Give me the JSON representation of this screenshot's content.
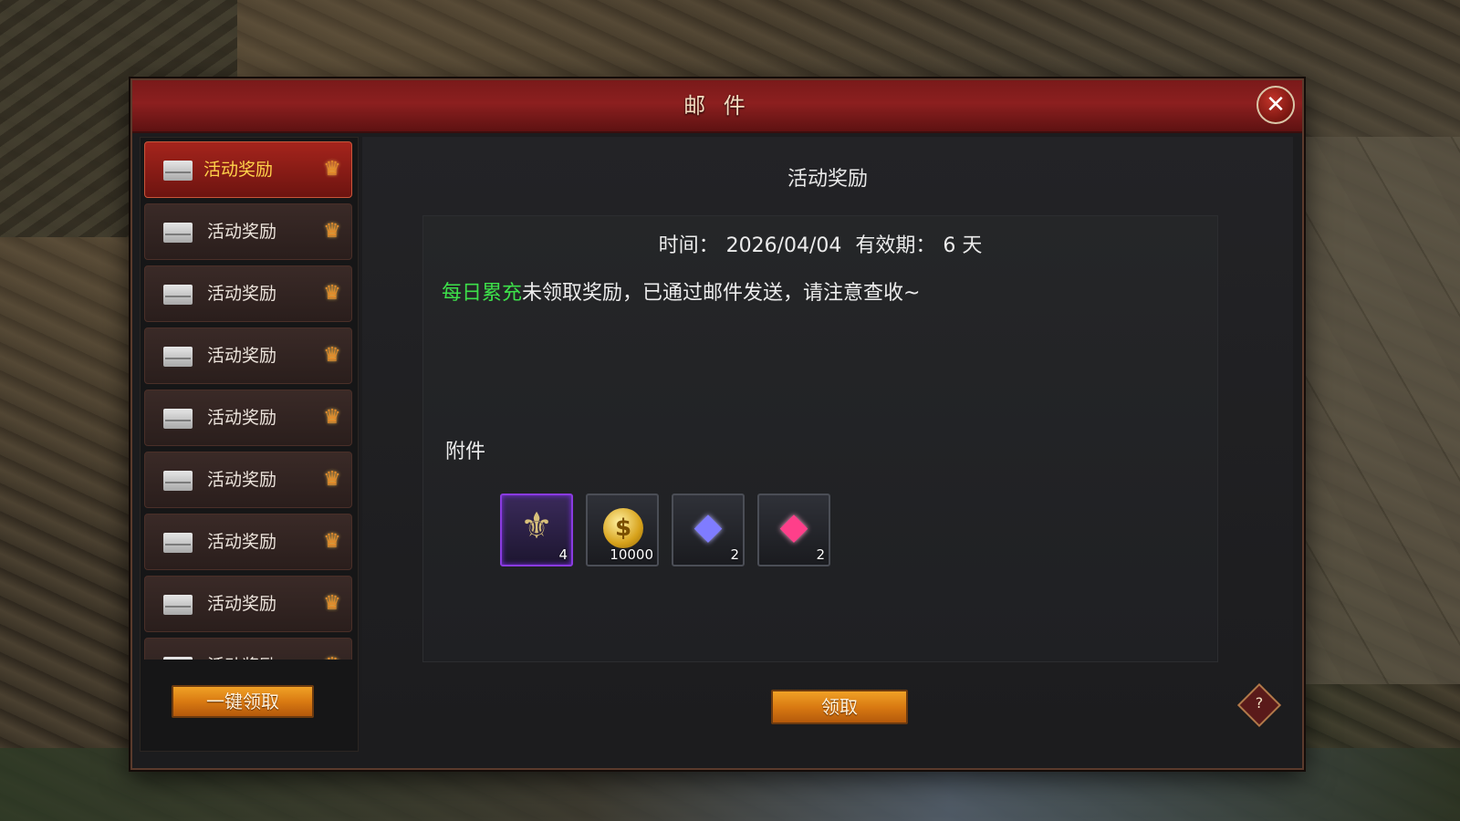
{
  "window": {
    "title": "邮 件"
  },
  "sidebar": {
    "items": [
      {
        "label": "活动奖励",
        "selected": true
      },
      {
        "label": "活动奖励",
        "selected": false
      },
      {
        "label": "活动奖励",
        "selected": false
      },
      {
        "label": "活动奖励",
        "selected": false
      },
      {
        "label": "活动奖励",
        "selected": false
      },
      {
        "label": "活动奖励",
        "selected": false
      },
      {
        "label": "活动奖励",
        "selected": false
      },
      {
        "label": "活动奖励",
        "selected": false
      },
      {
        "label": "活动奖励",
        "selected": false
      }
    ],
    "claim_all_label": "一键领取"
  },
  "mail": {
    "title": "活动奖励",
    "time_label": "时间：",
    "time_value": "2026/04/04",
    "validity_label": "有效期：",
    "validity_value": "6 天",
    "body_highlight": "每日累充",
    "body_text": "未领取奖励，已通过邮件发送，请注意查收~",
    "attachments_label": "附件",
    "attachments": [
      {
        "icon": "emblem-icon",
        "qty": "4",
        "rarity": "purple"
      },
      {
        "icon": "gold-coin-icon",
        "qty": "10000",
        "rarity": "normal"
      },
      {
        "icon": "blue-gem-icon",
        "qty": "2",
        "rarity": "normal"
      },
      {
        "icon": "pink-gem-icon",
        "qty": "2",
        "rarity": "normal"
      }
    ],
    "claim_label": "领取"
  },
  "help": {
    "label": "?"
  },
  "colors": {
    "title_bar": "#8c1f1f",
    "selected_item": "#a5241c",
    "highlight_text": "#3de04a",
    "button_gold": "#d97a12",
    "rare_border": "#8a3be0"
  }
}
